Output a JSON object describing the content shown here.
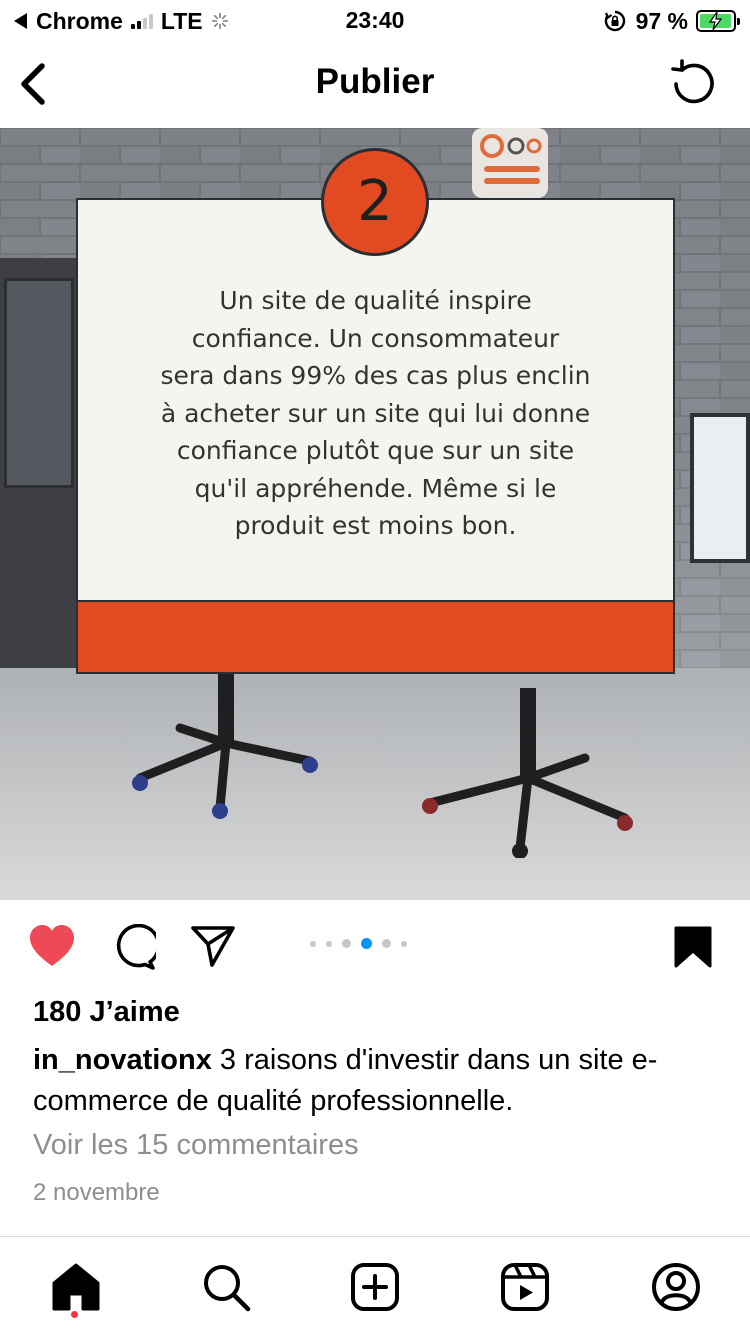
{
  "status_bar": {
    "app": "Chrome",
    "network": "LTE",
    "time": "23:40",
    "battery_percent": "97 %",
    "battery_level": 0.97
  },
  "header": {
    "title": "Publier",
    "back_icon": "chevron-left-icon",
    "refresh_icon": "refresh-icon"
  },
  "post": {
    "slide_number": "2",
    "slide_text": "Un site de qualité inspire confiance. Un consommateur sera dans 99% des cas plus enclin à acheter sur un site qui lui donne confiance plutôt que sur un site qu'il appréhende. Même si le produit est moins bon.",
    "slide_lines": [
      "Un site de qualité inspire",
      "confiance. Un consommateur",
      "sera dans 99% des cas plus enclin",
      "à acheter sur un site qui lui donne",
      "confiance plutôt que sur un site",
      "qu'il appréhende. Même si le",
      "produit est moins bon."
    ],
    "carousel": {
      "total": 6,
      "active_index": 3
    },
    "likes": "180 J’aime",
    "username": "in_novationx",
    "caption": "3 raisons d'investir dans un site e-commerce de qualité professionnelle.",
    "view_comments": "Voir les 15 commentaires",
    "date": "2 novembre"
  },
  "colors": {
    "accent_orange": "#e24a22",
    "like_red": "#ed4956",
    "muted_text": "#8e8e8e",
    "carousel_active": "#0095f6",
    "battery_green": "#4cd964"
  },
  "bottom_nav": [
    {
      "icon": "home-icon"
    },
    {
      "icon": "search-icon"
    },
    {
      "icon": "add-post-icon"
    },
    {
      "icon": "reels-icon"
    },
    {
      "icon": "profile-icon"
    }
  ]
}
